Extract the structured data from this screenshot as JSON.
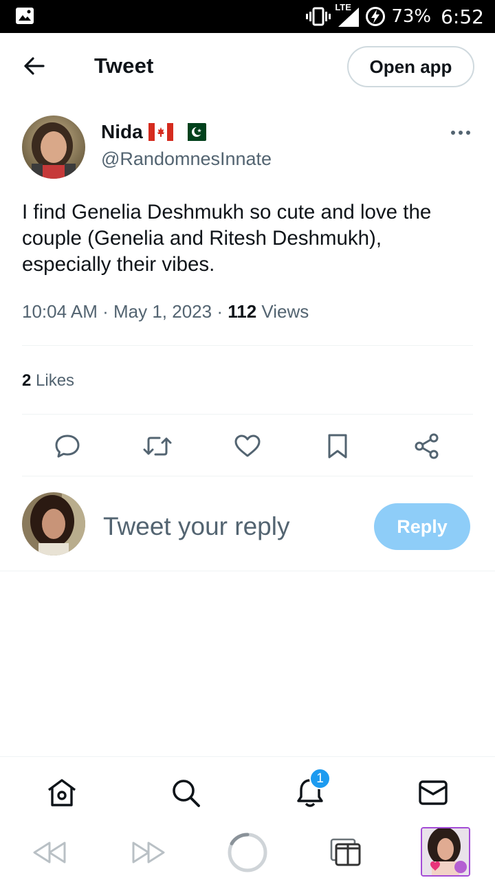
{
  "status_bar": {
    "network": "LTE",
    "battery": "73%",
    "time": "6:52"
  },
  "header": {
    "title": "Tweet",
    "open_app_label": "Open app"
  },
  "tweet": {
    "author_name": "Nida",
    "author_handle": "@RandomnesInnate",
    "flags": [
      "canada-flag",
      "pakistan-flag"
    ],
    "text": "I find Genelia Deshmukh so cute and love the couple (Genelia and Ritesh Deshmukh), especially their vibes.",
    "time": "10:04 AM",
    "date": "May 1, 2023",
    "views_count": "112",
    "views_label": "Views",
    "likes_count": "2",
    "likes_label": "Likes"
  },
  "actions": [
    "reply-icon",
    "retweet-icon",
    "like-icon",
    "bookmark-icon",
    "share-icon"
  ],
  "composer": {
    "placeholder": "Tweet your reply",
    "reply_label": "Reply"
  },
  "bottom_nav": {
    "items": [
      "home-icon",
      "search-icon",
      "notifications-icon",
      "messages-icon"
    ],
    "notification_badge": "1"
  },
  "browser_bar": {
    "items": [
      "back-icon",
      "forward-icon",
      "loading-icon",
      "tabs-icon",
      "profile-thumbnail"
    ]
  },
  "colors": {
    "accent": "#1d9bf0",
    "reply_button_disabled": "#8ecdf8",
    "secondary_text": "#536471",
    "primary_text": "#0f1419",
    "divider": "#eff3f4"
  }
}
